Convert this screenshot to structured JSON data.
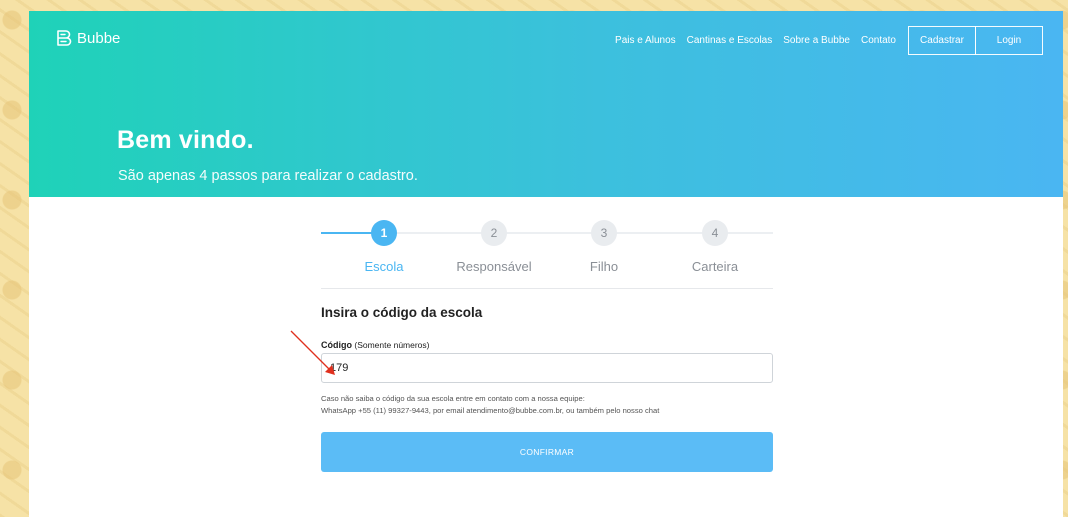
{
  "header": {
    "logo_text": "Bubbe",
    "logo_icon": "bubbe-logo-icon",
    "nav": [
      "Pais e Alunos",
      "Cantinas e Escolas",
      "Sobre a Bubbe",
      "Contato"
    ],
    "register_label": "Cadastrar",
    "login_label": "Login"
  },
  "hero": {
    "title": "Bem vindo.",
    "subtitle": "São apenas 4 passos para realizar o cadastro."
  },
  "stepper": {
    "steps": [
      {
        "number": "1",
        "label": "Escola",
        "active": true
      },
      {
        "number": "2",
        "label": "Responsável",
        "active": false
      },
      {
        "number": "3",
        "label": "Filho",
        "active": false
      },
      {
        "number": "4",
        "label": "Carteira",
        "active": false
      }
    ]
  },
  "form": {
    "title": "Insira o código da escola",
    "field_label": "Código",
    "field_hint": "(Somente números)",
    "field_value": "179",
    "help_line1": "Caso não saiba o código da sua escola entre em contato com a nossa equipe:",
    "help_line2": "WhatsApp +55 (11) 99327-9443, por email atendimento@bubbe.com.br, ou também pelo nosso chat",
    "submit_label": "CONFIRMAR"
  },
  "colors": {
    "accent": "#4ab6f2",
    "hero_start": "#1fd2b8",
    "hero_end": "#4ab6f2",
    "annotation_arrow": "#e0301e"
  }
}
